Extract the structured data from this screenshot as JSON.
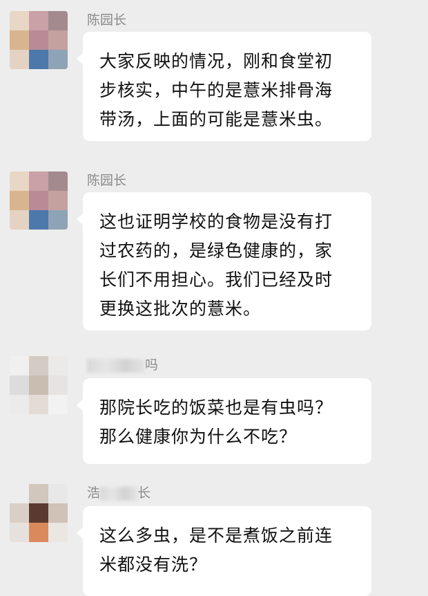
{
  "messages": [
    {
      "sender": "陈园长",
      "lines": [
        "大家反映的情况，刚和食堂初",
        "步核实，中午的是薏米排骨海",
        "带汤，上面的可能是薏米虫。"
      ]
    },
    {
      "sender": "陈园长",
      "lines": [
        "这也证明学校的食物是没有打",
        "过农药的，是绿色健康的，家",
        "长们不用担心。我们已经及时",
        "更换这批次的薏米。"
      ]
    },
    {
      "sender_prefix": "",
      "sender_suffix": "吗",
      "lines": [
        "那院长吃的饭菜也是有虫吗？",
        "那么健康你为什么不吃？"
      ]
    },
    {
      "sender_prefix": "浩",
      "sender_suffix": "长",
      "lines": [
        "这么多虫，是不是煮饭之前连",
        "米都没有洗？"
      ]
    }
  ],
  "colors": {
    "background": "#ededed",
    "bubble": "#ffffff",
    "sender_text": "#8a8a8a",
    "message_text": "#111111"
  }
}
